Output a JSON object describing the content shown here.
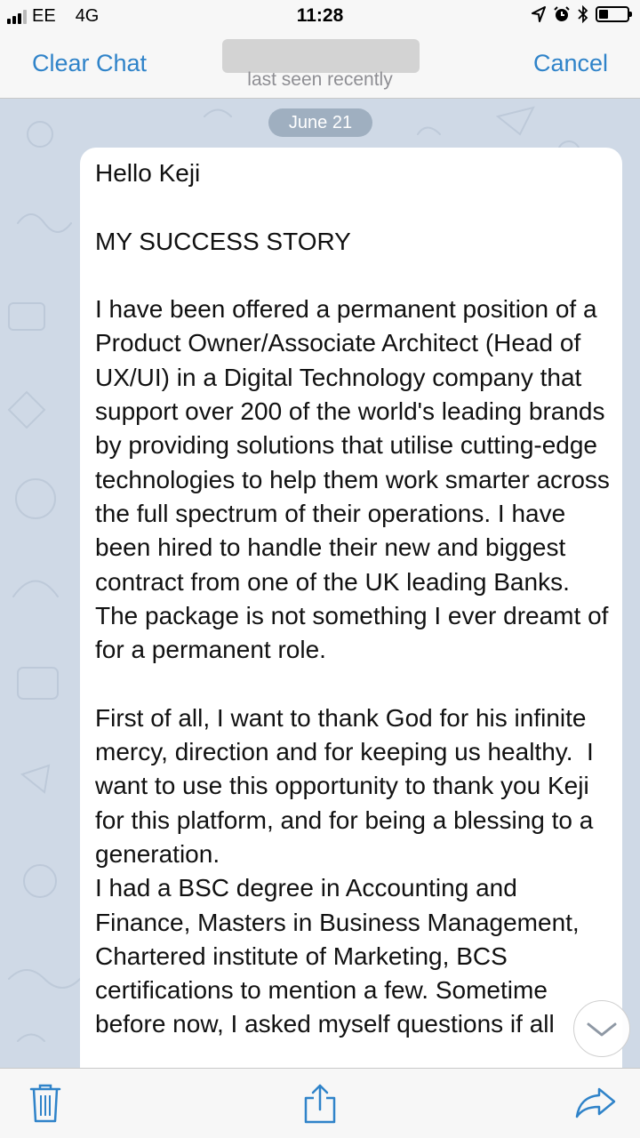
{
  "status_bar": {
    "carrier": "EE",
    "network": "4G",
    "time": "11:28"
  },
  "nav": {
    "left_button": "Clear Chat",
    "right_button": "Cancel",
    "subtitle": "last seen recently"
  },
  "chat": {
    "date_label": "June 21",
    "message": {
      "greeting": "Hello Keji",
      "heading": "MY SUCCESS STORY",
      "paragraph_1": "I have been offered a permanent position of a Product Owner/Associate Architect (Head of UX/UI) in a Digital Technology company that support over 200 of the world's leading brands by providing solutions that utilise cutting-edge technologies to help them work smarter across the full spectrum of their operations. I have been hired to handle their new and biggest contract from one of the UK leading Banks. The package is not something I ever dreamt of for a permanent role.",
      "paragraph_2": "First of all, I want to thank God for his infinite mercy, direction and for keeping us healthy.  I want to use this opportunity to thank you Keji for this platform, and for being a blessing to a generation.",
      "paragraph_3": "I had a BSC degree in Accounting and Finance, Masters in Business Management, Chartered institute of Marketing, BCS certifications to mention a few. Sometime before now, I asked myself questions if all"
    }
  },
  "icons": {
    "trash": "trash-icon",
    "share": "share-icon",
    "forward": "forward-icon",
    "scroll_down": "chevron-down-icon"
  },
  "colors": {
    "accent": "#2f83c9",
    "chat_background": "#cfd9e6",
    "bubble": "#ffffff"
  }
}
